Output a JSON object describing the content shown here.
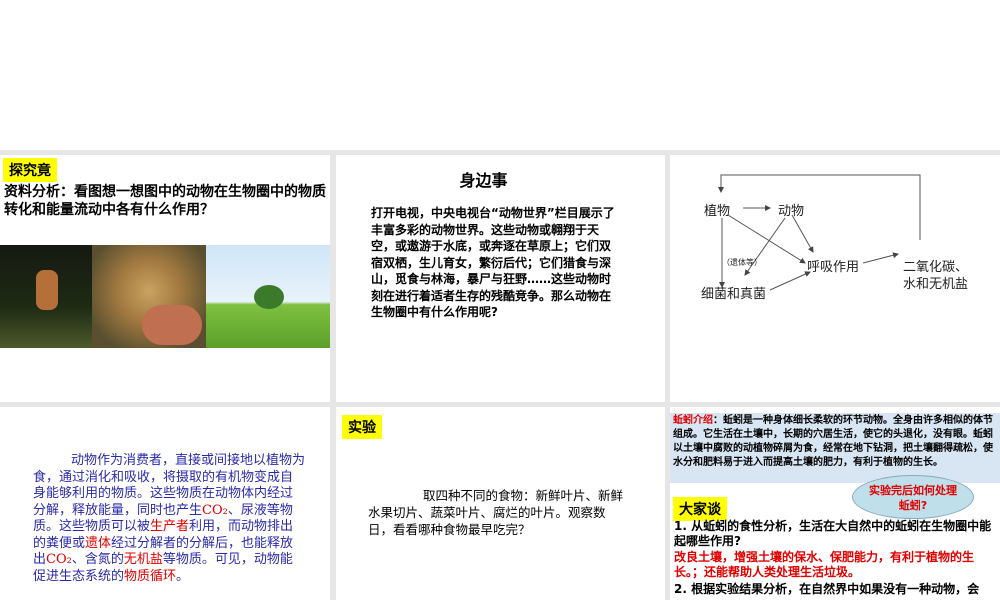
{
  "slide1": {
    "tag": "探究竟",
    "question": "资料分析：看图想一想图中的动物在生物圈中的物质转化和能量流动中各有什么作用？"
  },
  "slide2": {
    "title": "身边事",
    "body": "打开电视，中央电视台“动物世界”栏目展示了丰富多彩的动物世界。这些动物或翱翔于天空，或遨游于水底，或奔逐在草原上；它们双宿双栖，生儿育女，繁衍后代；它们猎食与深山，觅食与林海，暴尸与狂野……这些动物时刻在进行着适者生存的残酷竞争。那么动物在生物圈中有什么作用呢?"
  },
  "slide3": {
    "plant": "植物",
    "animal": "动物",
    "remains": "（遗体等）",
    "respiration": "呼吸作用",
    "bacteria": "细菌和真菌",
    "co2_line1": "二氧化碳、",
    "co2_line2": "水和无机盐"
  },
  "slide4": {
    "p1": "动物作为消费者，直接或间接地以植物为食，通过消化和吸收，将摄取的有机物变成自身能够利用的物质。这些物质在动物体内经过分解，释放能量，同时也产生",
    "co2a": "CO₂",
    "p2": "、尿液等物质。这些物质可以被",
    "producer": "生产者",
    "p3": "利用，而动物排出的粪便或",
    "remains": "遗体",
    "p4": "经过分解者的分解后，也能释放出",
    "co2b": "CO₂",
    "p5": "、含氮的",
    "salt": "无机盐",
    "p6": "等物质。可见，动物能促进生态系统的",
    "cycle": "物质循环",
    "p7": "。"
  },
  "slide5": {
    "tag": "实验",
    "body": "取四种不同的食物：新鲜叶片、新鲜水果切片、蔬菜叶片、腐烂的叶片。观察数日，看看哪种食物最早吃完？"
  },
  "slide6": {
    "intro_label": "蚯蚓介绍",
    "intro": "：蚯蚓是一种身体细长柔软的环节动物。全身由许多相似的体节组成。它生活在土壤中，长期的穴居生活，使它的头退化，没有眼。蚯蚓以土壤中腐败的动植物碎屑为食，经常在地下钻洞，把土壤翻得疏松，使水分和肥料易于进入而提高土壤的肥力，有利于植物的生长。",
    "cloud": "实验完后如何处理蚯蚓?",
    "tag": "大家谈",
    "q1": "1. 从蚯蚓的食性分析，生活在大自然中的蚯蚓在生物圈中能起哪些作用?",
    "a1": "改良土壤，增强土壤的保水、保肥能力，有利于植物的生长。；还能帮助人类处理生活垃圾。",
    "q2": "2. 根据实验结果分析，在自然界中如果没有一种动物，会"
  }
}
